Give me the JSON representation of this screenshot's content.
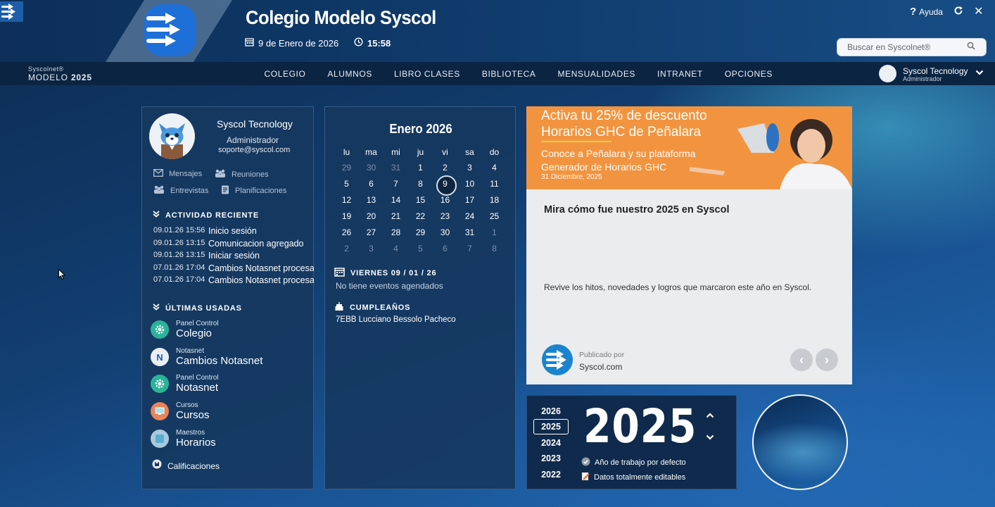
{
  "header": {
    "school_name": "Colegio Modelo Syscol",
    "date": "9 de Enero de 2026",
    "time": "15:58",
    "help_label": "Ayuda",
    "search_placeholder": "Buscar en Syscolnet®"
  },
  "brand": {
    "top": "Syscolnet®",
    "model": "MODELO",
    "year": "2025"
  },
  "nav": {
    "items": [
      "COLEGIO",
      "ALUMNOS",
      "LIBRO CLASES",
      "BIBLIOTECA",
      "MENSUALIDADES",
      "INTRANET",
      "OPCIONES"
    ]
  },
  "user": {
    "name": "Syscol Tecnology",
    "role": "Administrador"
  },
  "profile": {
    "name": "Syscol Tecnology",
    "role": "Administrador",
    "email": "soporte@syscol.com",
    "quick_links": [
      "Mensajes",
      "Reuniones",
      "Entrevistas",
      "Planificaciones"
    ]
  },
  "activity": {
    "title": "ACTIVIDAD RECIENTE",
    "rows": [
      {
        "time": "09.01.26 15:56",
        "text": "Inicio sesión"
      },
      {
        "time": "09.01.26 13:15",
        "text": "Comunicacion agregado"
      },
      {
        "time": "09.01.26 13:15",
        "text": "Iniciar sesión"
      },
      {
        "time": "07.01.26 17:04",
        "text": "Cambios Notasnet procesa"
      },
      {
        "time": "07.01.26 17:04",
        "text": "Cambios Notasnet procesa"
      }
    ]
  },
  "recent": {
    "title": "ÚLTIMAS USADAS",
    "items": [
      {
        "small": "Panel Control",
        "big": "Colegio"
      },
      {
        "small": "Notasnet",
        "big": "Cambios Notasnet"
      },
      {
        "small": "Panel Control",
        "big": "Notasnet"
      },
      {
        "small": "Cursos",
        "big": "Cursos"
      },
      {
        "small": "Maestros",
        "big": "Horarios"
      }
    ],
    "extra": "Calificaciones"
  },
  "calendar": {
    "title": "Enero 2026",
    "weekdays": [
      "lu",
      "ma",
      "mi",
      "ju",
      "vi",
      "sa",
      "do"
    ],
    "weeks": [
      [
        "29",
        "30",
        "31",
        "1",
        "2",
        "3",
        "4"
      ],
      [
        "5",
        "6",
        "7",
        "8",
        "9",
        "10",
        "11"
      ],
      [
        "12",
        "13",
        "14",
        "15",
        "16",
        "17",
        "18"
      ],
      [
        "19",
        "20",
        "21",
        "22",
        "23",
        "24",
        "25"
      ],
      [
        "26",
        "27",
        "28",
        "29",
        "30",
        "31",
        "1"
      ],
      [
        "2",
        "3",
        "4",
        "5",
        "6",
        "7",
        "8"
      ]
    ],
    "today": "9",
    "events_heading": "VIERNES 09 / 01 / 26",
    "events_text": "No tiene eventos agendados",
    "birthdays_heading": "CUMPLEAÑOS",
    "birthday_text": "7EBB  Lucciano Bessolo Pacheco"
  },
  "news": {
    "banner": {
      "line1": "Activa tu 25% de descuento",
      "line2": "Horarios GHC de Peñalara",
      "line3": "Conoce a Peñalara y su plataforma",
      "line4": "Generador de Horarios GHC",
      "date": "31 Diciembre, 2025"
    },
    "title": "Mira cómo fue nuestro 2025 en Syscol",
    "text": "Revive los hitos, novedades y logros que marcaron este año en Syscol.",
    "published_by": "Publicado por",
    "site": "Syscol.com"
  },
  "years": {
    "options": [
      "2026",
      "2025",
      "2024",
      "2023",
      "2022"
    ],
    "selected": "2025",
    "note1": "Año de trabajo por defecto",
    "note2": "Datos totalmente editables"
  },
  "colors": {
    "accent": "#1e6fd8",
    "banner": "#f2943f",
    "panel": "#163860"
  }
}
